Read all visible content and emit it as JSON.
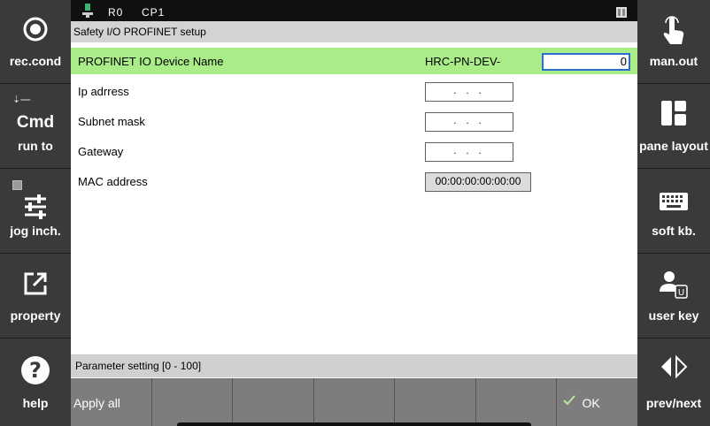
{
  "topbar": {
    "robot": "R0",
    "program": "CP1"
  },
  "dialog": {
    "title": "Safety I/O PROFINET setup",
    "rows": [
      {
        "name": "PROFINET IO Device Name",
        "prefix": "HRC-PN-DEV-",
        "value": "0"
      },
      {
        "name": "Ip adrress",
        "value": ".   .   ."
      },
      {
        "name": "Subnet mask",
        "value": ".   .   ."
      },
      {
        "name": "Gateway",
        "value": ".   .   ."
      },
      {
        "name": "MAC address",
        "value": "00:00:00:00:00:00"
      }
    ]
  },
  "status": "Parameter setting [0 - 100]",
  "fkeys": {
    "apply_all": "Apply all",
    "ok": "OK"
  },
  "left_panel": {
    "rec_cond": "rec.cond",
    "cmd": "Cmd",
    "run_to": "run to",
    "jog_inch": "jog inch.",
    "property": "property",
    "help": "help"
  },
  "right_panel": {
    "man_out": "man.out",
    "pane_layout": "pane layout",
    "soft_kb": "soft kb.",
    "user_key": "user key",
    "prev_next": "prev/next"
  },
  "colors": {
    "selected_row": "#aaec88",
    "side_panel": "#3a3a3a",
    "fkey": "#7d7d7d"
  }
}
